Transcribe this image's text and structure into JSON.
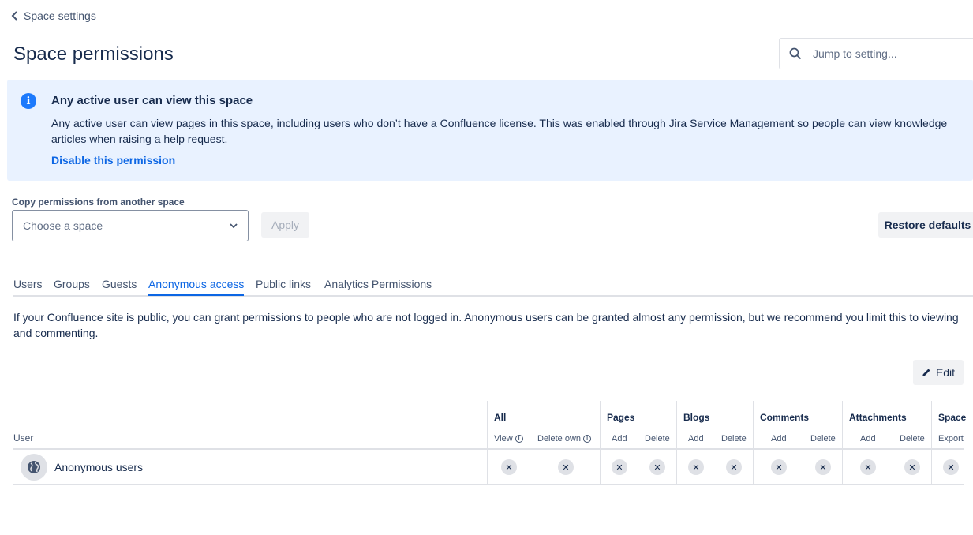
{
  "nav": {
    "back_label": "Space settings"
  },
  "page": {
    "title": "Space permissions"
  },
  "search": {
    "placeholder": "Jump to setting..."
  },
  "banner": {
    "title": "Any active user can view this space",
    "body": "Any active user can view pages in this space, including users who don’t have a Confluence license. This was enabled through Jira Service Management so people can view knowledge articles when raising a help request.",
    "link": "Disable this permission",
    "accent_color": "#1d7afc",
    "background_color": "#e9f2ff"
  },
  "copy": {
    "label": "Copy permissions from another space",
    "select_value": "Choose a space",
    "apply_label": "Apply",
    "restore_label": "Restore defaults"
  },
  "tabs": [
    {
      "label": "Users"
    },
    {
      "label": "Groups"
    },
    {
      "label": "Guests"
    },
    {
      "label": "Anonymous access",
      "active": true
    },
    {
      "label": "Public links"
    },
    {
      "label": "Analytics Permissions"
    }
  ],
  "description": "If your Confluence site is public, you can grant permissions to people who are not logged in. Anonymous users can be granted almost any permission, but we recommend you limit this to viewing and commenting.",
  "edit_label": "Edit",
  "table": {
    "user_header": "User",
    "groups": [
      {
        "label": "All",
        "subs": [
          "View",
          "Delete own"
        ]
      },
      {
        "label": "Pages",
        "subs": [
          "Add",
          "Delete"
        ]
      },
      {
        "label": "Blogs",
        "subs": [
          "Add",
          "Delete"
        ]
      },
      {
        "label": "Comments",
        "subs": [
          "Add",
          "Delete"
        ]
      },
      {
        "label": "Attachments",
        "subs": [
          "Add",
          "Delete"
        ]
      },
      {
        "label": "Space",
        "subs": [
          "Export"
        ]
      }
    ],
    "rows": [
      {
        "name": "Anonymous users",
        "permissions_granted": [
          false,
          false,
          false,
          false,
          false,
          false,
          false,
          false,
          false,
          false,
          false
        ]
      }
    ]
  }
}
